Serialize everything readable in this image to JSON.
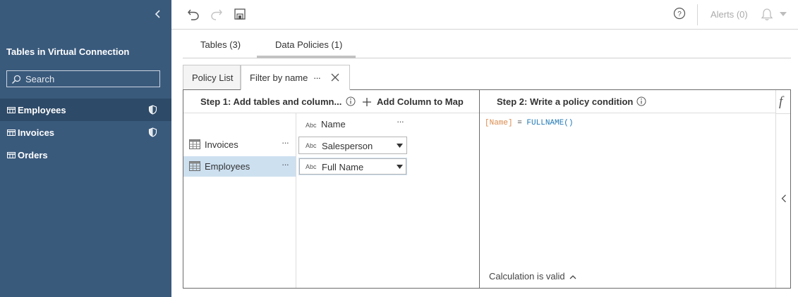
{
  "sidebar": {
    "title": "Tables in Virtual Connection",
    "search_placeholder": "Search",
    "items": [
      {
        "label": "Employees",
        "has_policy": true,
        "active": true
      },
      {
        "label": "Invoices",
        "has_policy": true,
        "active": false
      },
      {
        "label": "Orders",
        "has_policy": false,
        "active": false
      }
    ]
  },
  "toolbar": {
    "alerts_label": "Alerts (0)"
  },
  "main_tabs": [
    {
      "label": "Tables (3)",
      "active": false
    },
    {
      "label": "Data Policies (1)",
      "active": true
    }
  ],
  "sub_tabs": {
    "policy_list": "Policy List",
    "filter_tab": "Filter by name",
    "more": "···"
  },
  "step1": {
    "title": "Step 1: Add tables and column...",
    "add_column": "Add Column to Map",
    "column_header": {
      "type": "Abc",
      "label": "Name"
    },
    "tables": [
      {
        "label": "Invoices",
        "active": false,
        "mapped_type": "Abc",
        "mapped_column": "Salesperson"
      },
      {
        "label": "Employees",
        "active": true,
        "mapped_type": "Abc",
        "mapped_column": "Full Name"
      }
    ],
    "more": "···"
  },
  "step2": {
    "title": "Step 2: Write a policy condition",
    "code": {
      "field": "[Name]",
      "op": " = ",
      "fn": "FULLNAME()"
    },
    "status": "Calculation is valid",
    "fx": "f"
  },
  "colors": {
    "sidebar_bg": "#3a5a7c",
    "sidebar_active": "#2d4a68",
    "selected_row": "#cde0f0",
    "code_field": "#d98b4e",
    "code_function": "#1f78b4"
  }
}
